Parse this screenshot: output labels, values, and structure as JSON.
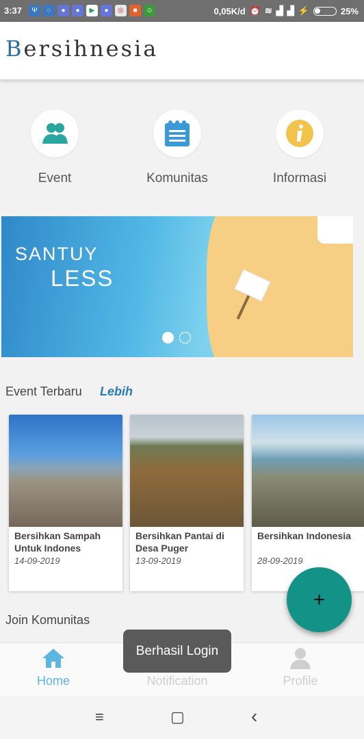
{
  "status_bar": {
    "time": "3:37",
    "speed": "0,05K/d",
    "battery": "25%",
    "app_icons": [
      "usb-icon",
      "messenger-icon",
      "discord-icon",
      "discord-icon",
      "play-store-icon",
      "discord-icon",
      "chrome-icon",
      "video-icon",
      "android-icon"
    ]
  },
  "app": {
    "logo_first_letter": "B",
    "logo_rest": "ersihnesia"
  },
  "menu": [
    {
      "label": "Event",
      "icon": "group-icon",
      "color": "#2aa6a0"
    },
    {
      "label": "Komunitas",
      "icon": "notepad-icon",
      "color": "#3a9ad6"
    },
    {
      "label": "Informasi",
      "icon": "info-icon",
      "color": "#f2c34b"
    }
  ],
  "banner": {
    "line1": "SANTUY",
    "line2": "LESS",
    "slides": 2,
    "active_slide": 0
  },
  "event_section": {
    "title": "Event Terbaru",
    "more": "Lebih"
  },
  "events": [
    {
      "title": "Bersihkan Sampah Untuk Indones",
      "date": "14-09-2019"
    },
    {
      "title": "Bersihkan Pantai di Desa Puger",
      "date": "13-09-2019"
    },
    {
      "title": "Bersihkan Indonesia",
      "date": "28-09-2019"
    }
  ],
  "community_section": {
    "title": "Join Komunitas"
  },
  "fab": {
    "label": "+"
  },
  "bottom_nav": [
    {
      "label": "Home",
      "icon": "home-icon",
      "active": true
    },
    {
      "label": "Notification",
      "icon": "bell-icon",
      "active": false
    },
    {
      "label": "Profile",
      "icon": "person-icon",
      "active": false
    }
  ],
  "toast": {
    "message": "Berhasil Login"
  },
  "system_nav": {
    "menu": "≡",
    "home": "▢",
    "back": "‹"
  },
  "colors": {
    "accent": "#139387",
    "primary": "#2a7bb0",
    "nav_active": "#5cb6e0"
  }
}
